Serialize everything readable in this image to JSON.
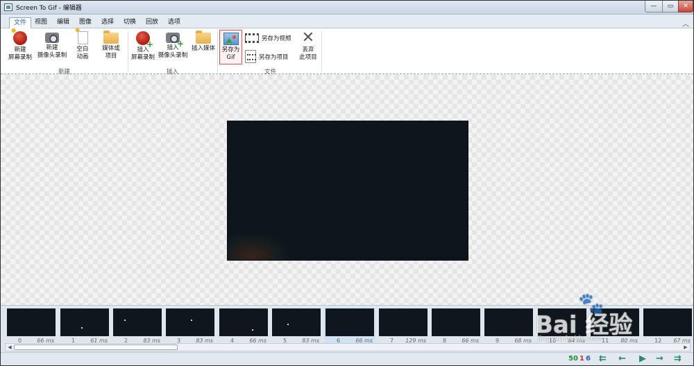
{
  "window": {
    "title": "Screen To Gif - 编辑器",
    "minimize": "—",
    "maximize": "▭",
    "close": "✕"
  },
  "tabs": [
    "文件",
    "视图",
    "编辑",
    "图像",
    "选择",
    "切换",
    "回放",
    "选项"
  ],
  "active_tab": "文件",
  "collapse_icon": "︿",
  "ribbon": {
    "new_group": {
      "label": "新建",
      "buttons": [
        "新建\n屏幕录制",
        "新建\n摄像头录制",
        "空白\n动画",
        "媒体或\n项目"
      ]
    },
    "insert_group": {
      "label": "插入",
      "buttons": [
        "插入\n屏幕录制",
        "插入\n摄像头录制",
        "插入媒体"
      ]
    },
    "file_group": {
      "label": "文件",
      "save_gif": "另存为\nGif",
      "save_video": "另存为视频",
      "save_project": "另存为项目",
      "discard": "丢弃\n此项目"
    }
  },
  "frames": [
    {
      "index": "0",
      "delay": "66 ms"
    },
    {
      "index": "1",
      "delay": "61 ms"
    },
    {
      "index": "2",
      "delay": "83 ms"
    },
    {
      "index": "3",
      "delay": "83 ms"
    },
    {
      "index": "4",
      "delay": "66 ms"
    },
    {
      "index": "5",
      "delay": "83 ms"
    },
    {
      "index": "6",
      "delay": "66 ms"
    },
    {
      "index": "7",
      "delay": "129 ms"
    },
    {
      "index": "8",
      "delay": "66 ms"
    },
    {
      "index": "9",
      "delay": "68 ms"
    },
    {
      "index": "10",
      "delay": "84 ms"
    },
    {
      "index": "11",
      "delay": "80 ms"
    },
    {
      "index": "12",
      "delay": "67 ms"
    }
  ],
  "selected_frame": "6",
  "status": {
    "total_frames": "50",
    "selected_count": "1",
    "current_frame": "6",
    "nav": [
      "⇇",
      "←",
      "▶",
      "→",
      "⇉"
    ]
  },
  "watermark": {
    "logo": "Bai  经验",
    "paw": "🐾",
    "url": "jingyan.baidu.com"
  },
  "colors": {
    "accent": "#1e5fa8",
    "selected_highlight": "#e05050",
    "count_total": "#1f8f2e",
    "count_selected": "#c0392b",
    "count_current": "#2a5fb0"
  }
}
